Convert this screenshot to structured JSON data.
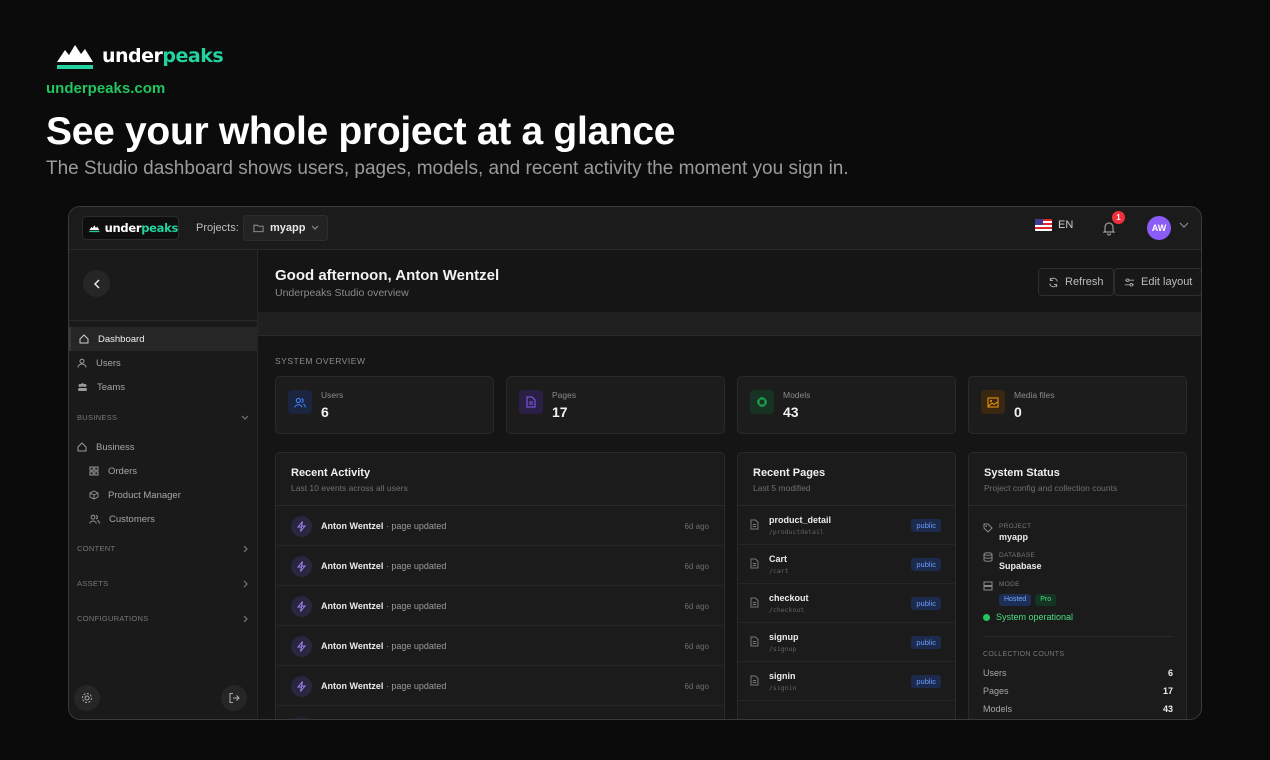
{
  "hero": {
    "brand_a": "under",
    "brand_b": "peaks",
    "url": "underpeaks.com",
    "title": "See your whole project at a glance",
    "subtitle": "The Studio dashboard shows users, pages, models, and recent activity the moment you sign in."
  },
  "topbar": {
    "brand_a": "under",
    "brand_b": "peaks",
    "projects_label": "Projects:",
    "project_name": "myapp",
    "language": "EN",
    "notification_count": "1",
    "avatar_initials": "AW"
  },
  "sidebar": {
    "items": [
      {
        "label": "Dashboard",
        "icon": "home-icon"
      },
      {
        "label": "Users",
        "icon": "user-icon"
      },
      {
        "label": "Teams",
        "icon": "team-icon"
      }
    ],
    "business_section": "BUSINESS",
    "business_items": [
      {
        "label": "Business",
        "icon": "home-icon"
      },
      {
        "label": "Orders",
        "icon": "grid-icon"
      },
      {
        "label": "Product Manager",
        "icon": "box-icon"
      },
      {
        "label": "Customers",
        "icon": "users-icon"
      }
    ],
    "sections": [
      "CONTENT",
      "ASSETS",
      "CONFIGURATIONS"
    ]
  },
  "header": {
    "greeting": "Good afternoon, Anton Wentzel",
    "subtitle": "Underpeaks Studio overview",
    "refresh_label": "Refresh",
    "edit_layout_label": "Edit layout"
  },
  "overview": {
    "label": "SYSTEM OVERVIEW",
    "stats": [
      {
        "label": "Users",
        "value": "6",
        "color": "#3b82f6"
      },
      {
        "label": "Pages",
        "value": "17",
        "color": "#8b5cf6"
      },
      {
        "label": "Models",
        "value": "43",
        "color": "#22c55e"
      },
      {
        "label": "Media files",
        "value": "0",
        "color": "#f59e0b"
      }
    ]
  },
  "activity": {
    "title": "Recent Activity",
    "subtitle": "Last 10 events across all users",
    "rows": [
      {
        "user": "Anton Wentzel",
        "action": " · page updated",
        "time": "6d ago"
      },
      {
        "user": "Anton Wentzel",
        "action": " · page updated",
        "time": "6d ago"
      },
      {
        "user": "Anton Wentzel",
        "action": " · page updated",
        "time": "6d ago"
      },
      {
        "user": "Anton Wentzel",
        "action": " · page updated",
        "time": "6d ago"
      },
      {
        "user": "Anton Wentzel",
        "action": " · page updated",
        "time": "6d ago"
      }
    ]
  },
  "pages": {
    "title": "Recent Pages",
    "subtitle": "Last 5 modified",
    "rows": [
      {
        "name": "product_detail",
        "path": "/productdetail",
        "status": "public"
      },
      {
        "name": "Cart",
        "path": "/cart",
        "status": "public"
      },
      {
        "name": "checkout",
        "path": "/checkout",
        "status": "public"
      },
      {
        "name": "signup",
        "path": "/signup",
        "status": "public"
      },
      {
        "name": "signin",
        "path": "/signin",
        "status": "public"
      }
    ]
  },
  "system": {
    "title": "System Status",
    "subtitle": "Project config and collection counts",
    "project_key": "PROJECT",
    "project_value": "myapp",
    "database_key": "DATABASE",
    "database_value": "Supabase",
    "mode_key": "MODE",
    "mode_tags": [
      "Hosted",
      "Pro"
    ],
    "status": "System operational",
    "counts_label": "COLLECTION COUNTS",
    "counts": [
      {
        "label": "Users",
        "value": "6"
      },
      {
        "label": "Pages",
        "value": "17"
      },
      {
        "label": "Models",
        "value": "43"
      }
    ]
  }
}
